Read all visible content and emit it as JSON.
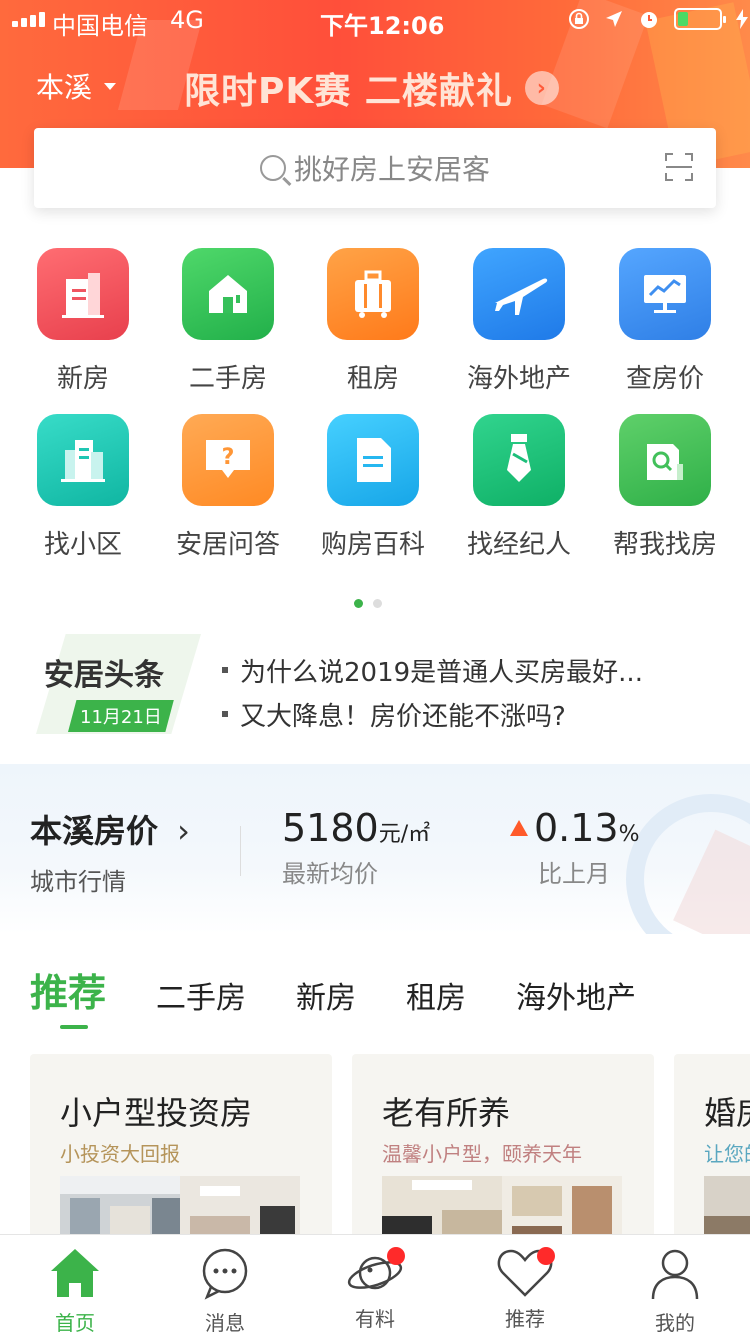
{
  "status": {
    "carrier": "中国电信",
    "network": "4G",
    "time": "下午12:06"
  },
  "header": {
    "city": "本溪",
    "promo": "限时PK赛 二楼献礼"
  },
  "search": {
    "placeholder": "挑好房上安居客"
  },
  "grid": {
    "row1": [
      {
        "label": "新房",
        "icon": "building-icon",
        "color": "#f05560"
      },
      {
        "label": "二手房",
        "icon": "house-icon",
        "color": "#36c05a"
      },
      {
        "label": "租房",
        "icon": "suitcase-icon",
        "color": "#ff8a2c"
      },
      {
        "label": "海外地产",
        "icon": "airplane-icon",
        "color": "#2f8bf2"
      },
      {
        "label": "查房价",
        "icon": "chart-board-icon",
        "color": "#3f8ff0"
      }
    ],
    "row2": [
      {
        "label": "找小区",
        "icon": "buildings-icon",
        "color": "#1fc6b3"
      },
      {
        "label": "安居问答",
        "icon": "question-bubble-icon",
        "color": "#ff9636"
      },
      {
        "label": "购房百科",
        "icon": "document-icon",
        "color": "#26b7f0"
      },
      {
        "label": "找经纪人",
        "icon": "tie-icon",
        "color": "#1dbe7a"
      },
      {
        "label": "帮我找房",
        "icon": "house-search-icon",
        "color": "#42c05a"
      }
    ]
  },
  "headlines": {
    "logo_text": "安居头条",
    "date": "11月21日",
    "items": [
      "为什么说2019是普通人买房最好...",
      "又大降息！房价还能不涨吗?"
    ]
  },
  "price": {
    "title": "本溪房价",
    "subtitle": "城市行情",
    "value": "5180",
    "unit": "元/㎡",
    "value_label": "最新均价",
    "change": "0.13",
    "change_unit": "%",
    "change_label": "比上月"
  },
  "tabs": [
    "推荐",
    "二手房",
    "新房",
    "租房",
    "海外地产"
  ],
  "cards": [
    {
      "title": "小户型投资房",
      "subtitle": "小投资大回报",
      "subtitle_color": "#b5945a"
    },
    {
      "title": "老有所养",
      "subtitle": "温馨小户型，颐养天年",
      "subtitle_color": "#c08080"
    },
    {
      "title": "婚房",
      "subtitle": "让您的",
      "subtitle_color": "#5aa7c0"
    }
  ],
  "nav": [
    {
      "label": "首页",
      "icon": "home-icon"
    },
    {
      "label": "消息",
      "icon": "message-icon"
    },
    {
      "label": "有料",
      "icon": "planet-icon"
    },
    {
      "label": "推荐",
      "icon": "heart-icon"
    },
    {
      "label": "我的",
      "icon": "user-icon"
    }
  ],
  "colors": {
    "accent": "#3cb34a",
    "header": "#ff5a3a"
  }
}
